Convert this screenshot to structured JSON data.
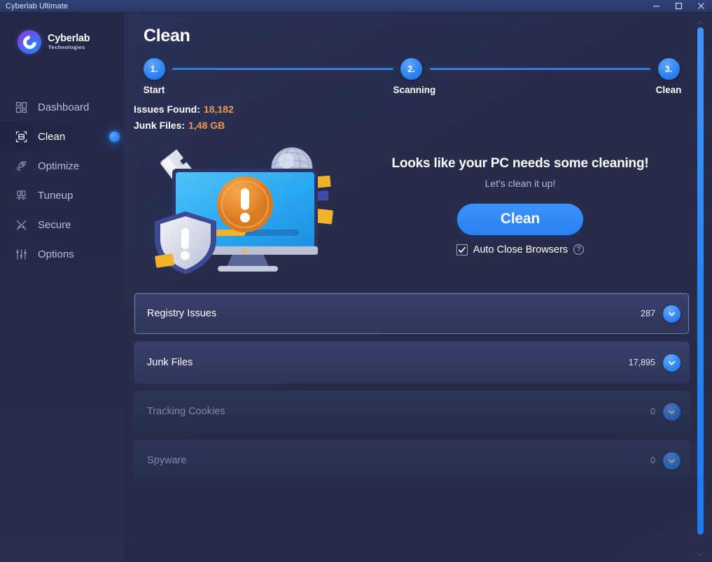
{
  "window": {
    "title": "Cyberlab Ultimate",
    "controls": {
      "minimize": "minimize-button",
      "maximize": "maximize-button",
      "close": "close-button"
    }
  },
  "brand": {
    "name": "Cyberlab",
    "subtitle": "Technologies",
    "logo_gradient_from": "#9040e4",
    "logo_gradient_to": "#2f7df5"
  },
  "sidebar": {
    "items": [
      {
        "label": "Dashboard",
        "icon": "dashboard-grid-icon",
        "active": false
      },
      {
        "label": "Clean",
        "icon": "scan-frame-icon",
        "active": true
      },
      {
        "label": "Optimize",
        "icon": "rocket-icon",
        "active": false
      },
      {
        "label": "Tuneup",
        "icon": "tuneup-icon",
        "active": false
      },
      {
        "label": "Secure",
        "icon": "tools-icon",
        "active": false
      },
      {
        "label": "Options",
        "icon": "sliders-icon",
        "active": false
      }
    ],
    "active_dot_color": "#2e86f7"
  },
  "header": {
    "title": "Clean"
  },
  "stepper": {
    "steps": [
      {
        "number": "1.",
        "label": "Start"
      },
      {
        "number": "2.",
        "label": "Scanning"
      },
      {
        "number": "3.",
        "label": "Clean"
      }
    ],
    "line_color": "#2f7ce8",
    "bubble_color": "#3086f4"
  },
  "stats": {
    "issues_label": "Issues Found:",
    "issues_value": "18,182",
    "junk_label": "Junk Files:",
    "junk_value": "1,48 GB",
    "value_color": "#eb9a4e"
  },
  "hero": {
    "title": "Looks like your PC needs some cleaning!",
    "subtitle": "Let's clean it up!",
    "clean_button": "Clean",
    "auto_close_label": "Auto Close Browsers",
    "auto_close_checked": true,
    "help_glyph": "?",
    "illustration": "pc-warning-illustration",
    "button_color": "#2a80f0"
  },
  "list": {
    "rows": [
      {
        "name": "Registry Issues",
        "count": "287",
        "dim": false,
        "focused": true
      },
      {
        "name": "Junk Files",
        "count": "17,895",
        "dim": false,
        "focused": false
      },
      {
        "name": "Tracking Cookies",
        "count": "0",
        "dim": true,
        "focused": false
      },
      {
        "name": "Spyware",
        "count": "0",
        "dim": true,
        "focused": false
      }
    ],
    "chevron_icon": "chevron-down-icon"
  },
  "scrollbar": {
    "up_icon": "scroll-up-arrow-icon",
    "down_icon": "scroll-down-arrow-icon",
    "thumb_color": "#2a82f2"
  }
}
